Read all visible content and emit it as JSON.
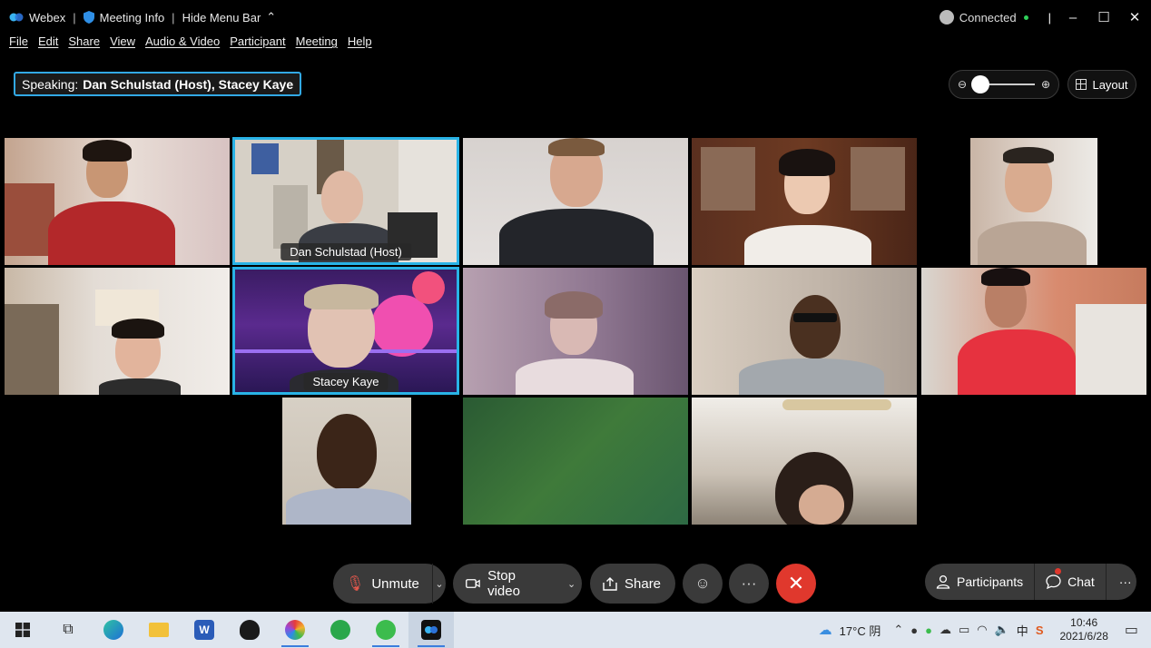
{
  "titlebar": {
    "app_name": "Webex",
    "meeting_info": "Meeting Info",
    "hide_menu_bar": "Hide Menu Bar",
    "status": "Connected"
  },
  "menu": [
    "File",
    "Edit",
    "Share",
    "View",
    "Audio & Video",
    "Participant",
    "Meeting",
    "Help"
  ],
  "speaking": {
    "prefix": "Speaking:",
    "names": "Dan Schulstad (Host), Stacey Kaye"
  },
  "layout_label": "Layout",
  "tiles": [
    {
      "name": "",
      "label": ""
    },
    {
      "name": "Dan Schulstad (Host)",
      "label": "Dan Schulstad (Host)"
    },
    {
      "name": "",
      "label": ""
    },
    {
      "name": "",
      "label": ""
    },
    {
      "name": "",
      "label": ""
    },
    {
      "name": "",
      "label": ""
    },
    {
      "name": "Stacey Kaye",
      "label": "Stacey Kaye"
    },
    {
      "name": "",
      "label": ""
    },
    {
      "name": "",
      "label": ""
    },
    {
      "name": "",
      "label": ""
    },
    {
      "name": "",
      "label": ""
    },
    {
      "name": "",
      "label": ""
    },
    {
      "name": "",
      "label": ""
    }
  ],
  "controls": {
    "unmute": "Unmute",
    "stop_video": "Stop video",
    "share": "Share",
    "more": "···",
    "participants": "Participants",
    "chat": "Chat",
    "panel_more": "···"
  },
  "taskbar": {
    "weather": "17°C 阴",
    "time": "10:46",
    "date": "2021/6/28",
    "ime": "中"
  },
  "colors": {
    "active_speaker_border": "#29b3e6",
    "end_call": "#e0382d",
    "control_bg": "#3a3a3a",
    "connected": "#2fd05a"
  }
}
